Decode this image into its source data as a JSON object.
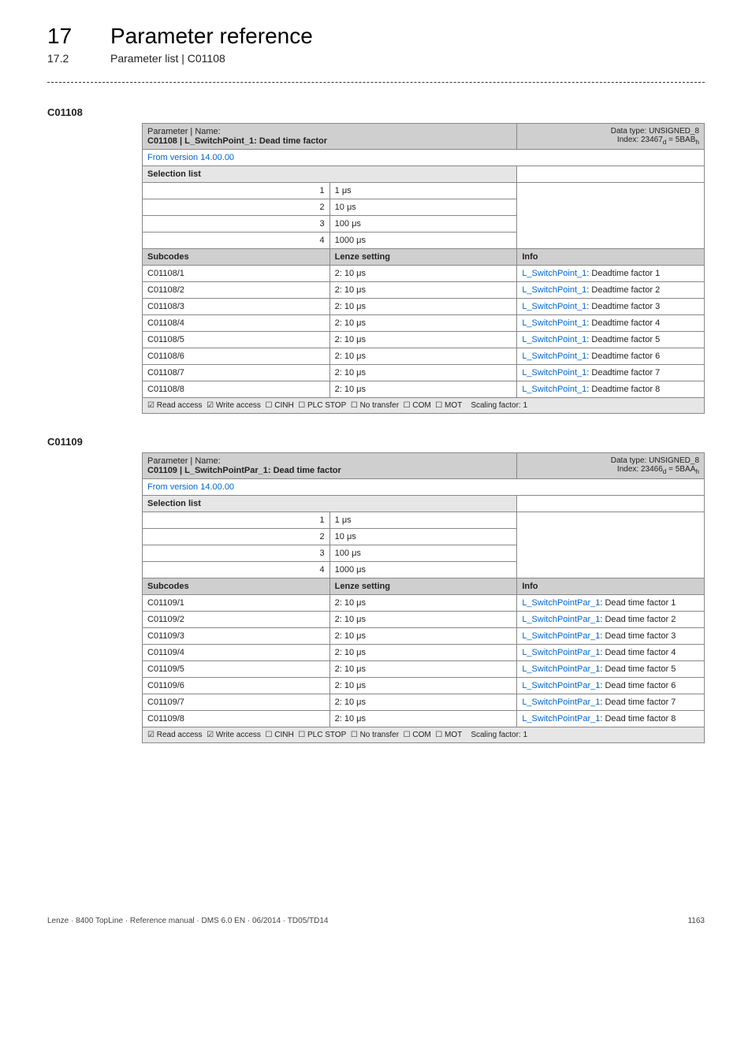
{
  "header": {
    "chapnum": "17",
    "chaptitle": "Parameter reference",
    "subnum": "17.2",
    "subtitle": "Parameter list | C01108"
  },
  "blocks": [
    {
      "code_label": "C01108",
      "name_label": "Parameter | Name:",
      "name_value": "C01108 | L_SwitchPoint_1: Dead time factor",
      "datatype": "Data type: UNSIGNED_8",
      "index_pre": "Index: 23467",
      "index_sub_d": "d",
      "index_mid": " = 5BAB",
      "index_sub_h": "h",
      "version": "From version 14.00.00",
      "selection_label": "Selection list",
      "selections": [
        {
          "n": "1",
          "v": "1 μs"
        },
        {
          "n": "2",
          "v": "10 μs"
        },
        {
          "n": "3",
          "v": "100 μs"
        },
        {
          "n": "4",
          "v": "1000 μs"
        }
      ],
      "subcodes_label": "Subcodes",
      "lenze_label": "Lenze setting",
      "info_label": "Info",
      "rows": [
        {
          "c": "C01108/1",
          "s": "2: 10 μs",
          "link": "L_SwitchPoint_1",
          "suffix": ": Deadtime factor 1"
        },
        {
          "c": "C01108/2",
          "s": "2: 10 μs",
          "link": "L_SwitchPoint_1",
          "suffix": ": Deadtime factor 2"
        },
        {
          "c": "C01108/3",
          "s": "2: 10 μs",
          "link": "L_SwitchPoint_1",
          "suffix": ": Deadtime factor 3"
        },
        {
          "c": "C01108/4",
          "s": "2: 10 μs",
          "link": "L_SwitchPoint_1",
          "suffix": ": Deadtime factor 4"
        },
        {
          "c": "C01108/5",
          "s": "2: 10 μs",
          "link": "L_SwitchPoint_1",
          "suffix": ": Deadtime factor 5"
        },
        {
          "c": "C01108/6",
          "s": "2: 10 μs",
          "link": "L_SwitchPoint_1",
          "suffix": ": Deadtime factor 6"
        },
        {
          "c": "C01108/7",
          "s": "2: 10 μs",
          "link": "L_SwitchPoint_1",
          "suffix": ": Deadtime factor 7"
        },
        {
          "c": "C01108/8",
          "s": "2: 10 μs",
          "link": "L_SwitchPoint_1",
          "suffix": ": Deadtime factor 8"
        }
      ],
      "footer_items": [
        {
          "sym": "☑",
          "txt": "Read access"
        },
        {
          "sym": "☑",
          "txt": "Write access"
        },
        {
          "sym": "☐",
          "txt": "CINH"
        },
        {
          "sym": "☐",
          "txt": "PLC STOP"
        },
        {
          "sym": "☐",
          "txt": "No transfer"
        },
        {
          "sym": "☐",
          "txt": "COM"
        },
        {
          "sym": "☐",
          "txt": "MOT"
        }
      ],
      "scaling": "Scaling factor: 1"
    },
    {
      "code_label": "C01109",
      "name_label": "Parameter | Name:",
      "name_value": "C01109 | L_SwitchPointPar_1: Dead time factor",
      "datatype": "Data type: UNSIGNED_8",
      "index_pre": "Index: 23466",
      "index_sub_d": "d",
      "index_mid": " = 5BAA",
      "index_sub_h": "h",
      "version": "From version 14.00.00",
      "selection_label": "Selection list",
      "selections": [
        {
          "n": "1",
          "v": "1 μs"
        },
        {
          "n": "2",
          "v": "10 μs"
        },
        {
          "n": "3",
          "v": "100 μs"
        },
        {
          "n": "4",
          "v": "1000 μs"
        }
      ],
      "subcodes_label": "Subcodes",
      "lenze_label": "Lenze setting",
      "info_label": "Info",
      "rows": [
        {
          "c": "C01109/1",
          "s": "2: 10 μs",
          "link": "L_SwitchPointPar_1",
          "suffix": ": Dead time factor 1"
        },
        {
          "c": "C01109/2",
          "s": "2: 10 μs",
          "link": "L_SwitchPointPar_1",
          "suffix": ": Dead time factor 2"
        },
        {
          "c": "C01109/3",
          "s": "2: 10 μs",
          "link": "L_SwitchPointPar_1",
          "suffix": ": Dead time factor 3"
        },
        {
          "c": "C01109/4",
          "s": "2: 10 μs",
          "link": "L_SwitchPointPar_1",
          "suffix": ": Dead time factor 4"
        },
        {
          "c": "C01109/5",
          "s": "2: 10 μs",
          "link": "L_SwitchPointPar_1",
          "suffix": ": Dead time factor 5"
        },
        {
          "c": "C01109/6",
          "s": "2: 10 μs",
          "link": "L_SwitchPointPar_1",
          "suffix": ": Dead time factor 6"
        },
        {
          "c": "C01109/7",
          "s": "2: 10 μs",
          "link": "L_SwitchPointPar_1",
          "suffix": ": Dead time factor 7"
        },
        {
          "c": "C01109/8",
          "s": "2: 10 μs",
          "link": "L_SwitchPointPar_1",
          "suffix": ": Dead time factor 8"
        }
      ],
      "footer_items": [
        {
          "sym": "☑",
          "txt": "Read access"
        },
        {
          "sym": "☑",
          "txt": "Write access"
        },
        {
          "sym": "☐",
          "txt": "CINH"
        },
        {
          "sym": "☐",
          "txt": "PLC STOP"
        },
        {
          "sym": "☐",
          "txt": "No transfer"
        },
        {
          "sym": "☐",
          "txt": "COM"
        },
        {
          "sym": "☐",
          "txt": "MOT"
        }
      ],
      "scaling": "Scaling factor: 1"
    }
  ],
  "page_footer": {
    "left": "Lenze · 8400 TopLine · Reference manual · DMS 6.0 EN · 06/2014 · TD05/TD14",
    "right": "1163"
  }
}
